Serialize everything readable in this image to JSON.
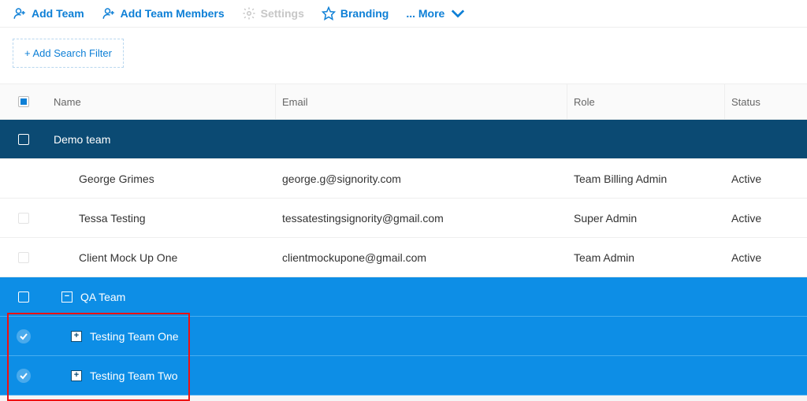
{
  "toolbar": {
    "add_team": "Add Team",
    "add_members": "Add Team Members",
    "settings": "Settings",
    "branding": "Branding",
    "more": "... More"
  },
  "filter": {
    "add_label": "+ Add Search Filter"
  },
  "columns": {
    "name": "Name",
    "email": "Email",
    "role": "Role",
    "status": "Status"
  },
  "teams": {
    "demo": {
      "label": "Demo team"
    },
    "qa": {
      "label": "QA Team"
    },
    "t1": {
      "label": "Testing Team One"
    },
    "t2": {
      "label": "Testing Team Two"
    }
  },
  "members": {
    "m0": {
      "name": "George Grimes",
      "email": "george.g@signority.com",
      "role": "Team Billing Admin",
      "status": "Active"
    },
    "m1": {
      "name": "Tessa Testing",
      "email": "tessatestingsignority@gmail.com",
      "role": "Super Admin",
      "status": "Active"
    },
    "m2": {
      "name": "Client Mock Up One",
      "email": "clientmockupone@gmail.com",
      "role": "Team Admin",
      "status": "Active"
    }
  }
}
